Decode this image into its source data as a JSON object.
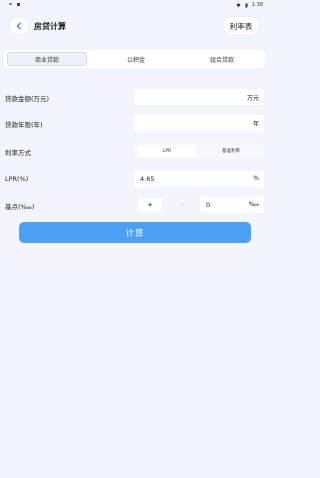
{
  "status_bar": {
    "time": "1:38"
  },
  "header": {
    "title": "房贷计算",
    "rate_table_label": "利率表"
  },
  "tabs": [
    {
      "label": "商业贷款",
      "active": true
    },
    {
      "label": "公积金",
      "active": false
    },
    {
      "label": "组合贷款",
      "active": false
    }
  ],
  "form": {
    "loan_amount": {
      "label": "贷款金额(万元)",
      "value": "",
      "suffix": "万元"
    },
    "loan_years": {
      "label": "贷款年限(年)",
      "value": "",
      "suffix": "年"
    },
    "rate_mode": {
      "label": "利率方式",
      "options": [
        "LPR",
        "基准利率"
      ],
      "selected": "LPR"
    },
    "lpr": {
      "label": "LPR(%)",
      "value": "4.65",
      "suffix": "%"
    },
    "basis_points": {
      "label": "基点(‱)",
      "plus": "+",
      "minus": "-",
      "value": "0",
      "suffix": "‱"
    }
  },
  "calculate_label": "计算",
  "colors": {
    "background": "#f2f5fc",
    "accent": "#4aa0f5"
  }
}
